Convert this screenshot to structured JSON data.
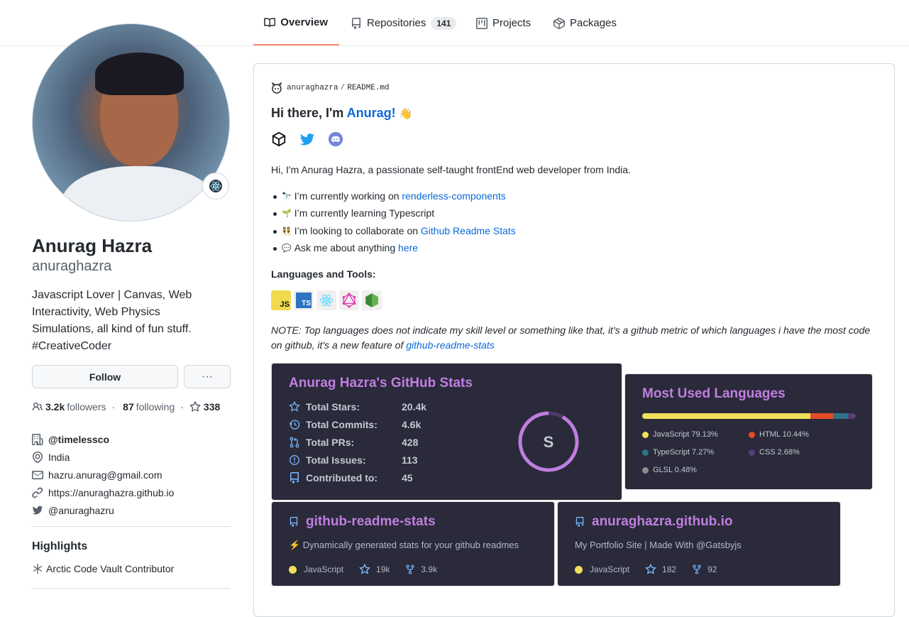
{
  "tabs": [
    {
      "label": "Overview",
      "icon": "book-icon",
      "active": true
    },
    {
      "label": "Repositories",
      "icon": "repo-icon",
      "count": "141"
    },
    {
      "label": "Projects",
      "icon": "project-icon"
    },
    {
      "label": "Packages",
      "icon": "package-icon"
    }
  ],
  "profile": {
    "name": "Anurag Hazra",
    "login": "anuraghazra",
    "bio": "Javascript Lover | Canvas, Web Interactivity, Web Physics Simulations, all kind of fun stuff. #CreativeCoder",
    "follow_label": "Follow",
    "more_label": "···",
    "followers_count": "3.2k",
    "followers_label": "followers",
    "following_count": "87",
    "following_label": "following",
    "stars_count": "338",
    "org": "@timelessco",
    "location": "India",
    "email": "hazru.anurag@gmail.com",
    "website": "https://anuraghazra.github.io",
    "twitter": "@anuraghazru",
    "highlights_title": "Highlights",
    "highlight_item": "Arctic Code Vault Contributor"
  },
  "readme": {
    "owner": "anuraghazra",
    "sep": "/",
    "file": "README.md",
    "greeting": "Hi there, I'm ",
    "greeting_name": "Anurag!",
    "greeting_emoji": "👋",
    "intro": "Hi, I'm Anurag Hazra, a passionate self-taught frontEnd web developer from India.",
    "bullets": [
      {
        "emoji": "🔭",
        "text": "I’m currently working on ",
        "link": "renderless-components"
      },
      {
        "emoji": "🌱",
        "text": "I’m currently learning Typescript",
        "link": ""
      },
      {
        "emoji": "👯",
        "text": "I’m looking to collaborate on ",
        "link": "Github Readme Stats"
      },
      {
        "emoji": "💬",
        "text": "Ask me about anything ",
        "link": "here"
      }
    ],
    "languages_title": "Languages and Tools:",
    "lang_badges": [
      "JS",
      "TS"
    ],
    "note": "NOTE: Top languages does not indicate my skill level or something like that, it's a github metric of which languages i have the most code on github, it's a new feature of ",
    "note_link": "github-readme-stats"
  },
  "stats_card": {
    "title": "Anurag Hazra's GitHub Stats",
    "rows": [
      {
        "label": "Total Stars:",
        "value": "20.4k",
        "icon": "star-icon"
      },
      {
        "label": "Total Commits:",
        "value": "4.6k",
        "icon": "history-icon"
      },
      {
        "label": "Total PRs:",
        "value": "428",
        "icon": "pr-icon"
      },
      {
        "label": "Total Issues:",
        "value": "113",
        "icon": "issue-icon"
      },
      {
        "label": "Contributed to:",
        "value": "45",
        "icon": "repo-icon"
      }
    ],
    "grade": "S",
    "accent": "#c07ee0"
  },
  "langs_card": {
    "title": "Most Used Languages",
    "items": [
      {
        "name": "JavaScript 79.13%",
        "pct": 79.13,
        "color": "#f1e05a"
      },
      {
        "name": "HTML 10.44%",
        "pct": 10.44,
        "color": "#e34c26"
      },
      {
        "name": "TypeScript 7.27%",
        "pct": 7.27,
        "color": "#2b7489"
      },
      {
        "name": "CSS 2.68%",
        "pct": 2.68,
        "color": "#563d7c"
      },
      {
        "name": "GLSL 0.48%",
        "pct": 0.48,
        "color": "#8c8c8c"
      }
    ]
  },
  "repo_cards": [
    {
      "name": "github-readme-stats",
      "desc": "⚡ Dynamically generated stats for your github readmes",
      "lang": "JavaScript",
      "stars": "19k",
      "forks": "3.9k"
    },
    {
      "name": "anuraghazra.github.io",
      "desc": "My Portfolio Site | Made With @Gatsbyjs",
      "lang": "JavaScript",
      "stars": "182",
      "forks": "92"
    }
  ]
}
